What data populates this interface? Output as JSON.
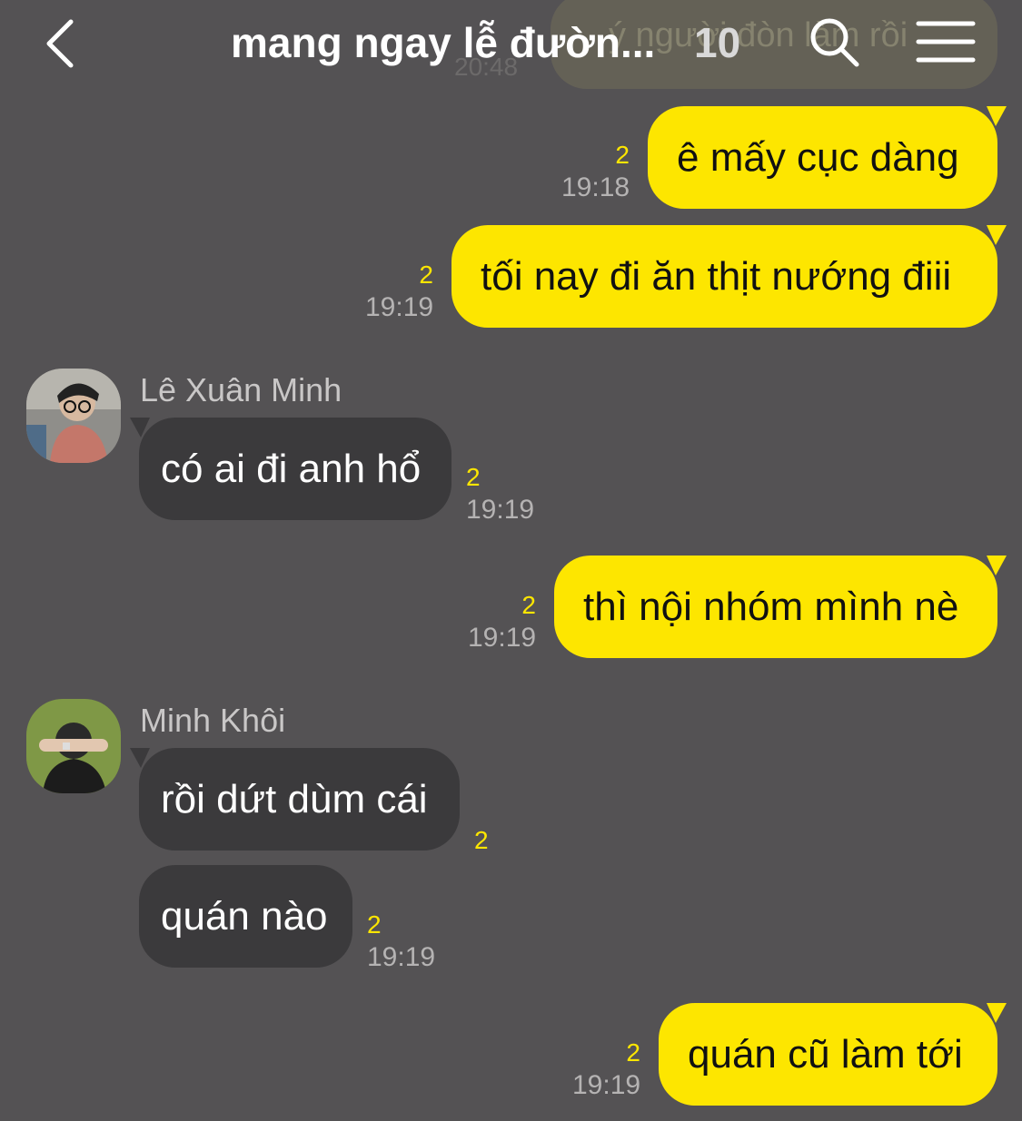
{
  "header": {
    "title": "mang ngay lễ đườn...",
    "member_count": "10",
    "back_icon": "chevron-left-icon",
    "search_icon": "search-icon",
    "menu_icon": "hamburger-menu-icon",
    "ghost_message": "ý người đòn làm rồi",
    "ghost_time": "20:48"
  },
  "colors": {
    "background": "#545254",
    "outgoing_bubble": "#fde600",
    "incoming_bubble": "#3b3a3c",
    "unread_count": "#fde600"
  },
  "messages": [
    {
      "direction": "out",
      "text": "ê mấy cục dàng",
      "unread": "2",
      "time": "19:18"
    },
    {
      "direction": "out",
      "text": "tối nay đi ăn thịt nướng điii",
      "unread": "2",
      "time": "19:19"
    },
    {
      "direction": "in",
      "sender": "Lê Xuân Minh",
      "text": "có ai đi anh hổ",
      "unread": "2",
      "time": "19:19"
    },
    {
      "direction": "out",
      "text": "thì nội nhóm mình nè",
      "unread": "2",
      "time": "19:19"
    },
    {
      "direction": "in",
      "sender": "Minh Khôi",
      "text": "rồi dứt dùm cái",
      "unread": "2",
      "time": ""
    },
    {
      "direction": "in",
      "sender": "",
      "text": "quán nào",
      "unread": "2",
      "time": "19:19"
    },
    {
      "direction": "out",
      "text": "quán cũ làm tới",
      "unread": "2",
      "time": "19:19"
    }
  ]
}
